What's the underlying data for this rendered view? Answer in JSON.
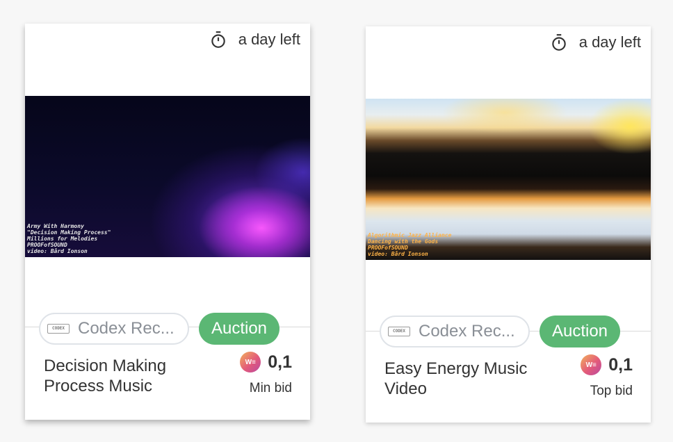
{
  "cards": [
    {
      "time_left": "a day left",
      "media_credits": "Army With Harmony\n\"Decision Making Process\"\nMillions for Melodies\nPROOFofSOUND\nvideo: Bård Ionson",
      "collection": "Codex Rec...",
      "codex_logo_text": "CODEX",
      "sale_type": "Auction",
      "title": "Decision Making Process Music",
      "currency_badge": "W≡",
      "price": "0,1",
      "price_label": "Min bid",
      "accent_color": "#5bb774"
    },
    {
      "time_left": "a day left",
      "media_credits": "Algorithmic Jazz Alliance\nDancing with the Gods\nPROOFofSOUND\nvideo: Bård Ionson",
      "collection": "Codex Rec...",
      "codex_logo_text": "CODEX",
      "sale_type": "Auction",
      "title": "Easy Energy Music Video",
      "currency_badge": "W≡",
      "price": "0,1",
      "price_label": "Top bid",
      "accent_color": "#5bb774"
    }
  ]
}
